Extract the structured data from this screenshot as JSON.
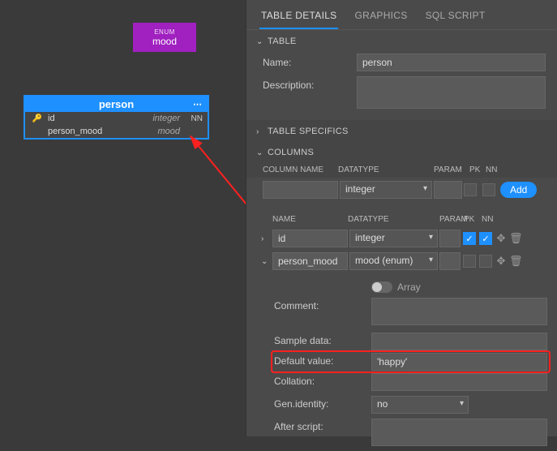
{
  "enum": {
    "typeLabel": "ENUM",
    "name": "mood"
  },
  "table": {
    "name": "person",
    "columns": [
      {
        "name": "id",
        "type": "integer",
        "nn": "NN",
        "pk": true
      },
      {
        "name": "person_mood",
        "type": "mood",
        "nn": "",
        "pk": false
      }
    ]
  },
  "panel": {
    "tabs": [
      {
        "label": "TABLE DETAILS",
        "active": true
      },
      {
        "label": "GRAPHICS",
        "active": false
      },
      {
        "label": "SQL SCRIPT",
        "active": false
      }
    ],
    "sections": {
      "table": {
        "label": "TABLE",
        "nameLabel": "Name:",
        "nameValue": "person",
        "descLabel": "Description:",
        "descValue": ""
      },
      "specifics": {
        "label": "TABLE SPECIFICS"
      },
      "columns": {
        "label": "COLUMNS",
        "headers": {
          "name": "COLUMN NAME",
          "datatype": "DATATYPE",
          "param": "PARAM",
          "pk": "PK",
          "nn": "NN"
        },
        "newRow": {
          "name": "",
          "datatype": "integer",
          "addLabel": "Add"
        },
        "listHeaders": {
          "name": "NAME",
          "datatype": "DATATYPE",
          "param": "PARAM",
          "pk": "PK",
          "nn": "NN"
        },
        "list": [
          {
            "expanded": false,
            "name": "id",
            "datatype": "integer",
            "param": "",
            "pk": true,
            "nn": true
          },
          {
            "expanded": true,
            "name": "person_mood",
            "datatype": "mood (enum)",
            "param": "",
            "pk": false,
            "nn": false
          }
        ],
        "detail": {
          "arrayLabel": "Array",
          "arrayOn": false,
          "commentLabel": "Comment:",
          "commentValue": "",
          "sampleLabel": "Sample data:",
          "sampleValue": "",
          "defaultLabel": "Default value:",
          "defaultValue": "'happy'",
          "collationLabel": "Collation:",
          "collationValue": "",
          "genIdentityLabel": "Gen.identity:",
          "genIdentityValue": "no",
          "afterScriptLabel": "After script:",
          "afterScriptValue": ""
        }
      }
    }
  }
}
